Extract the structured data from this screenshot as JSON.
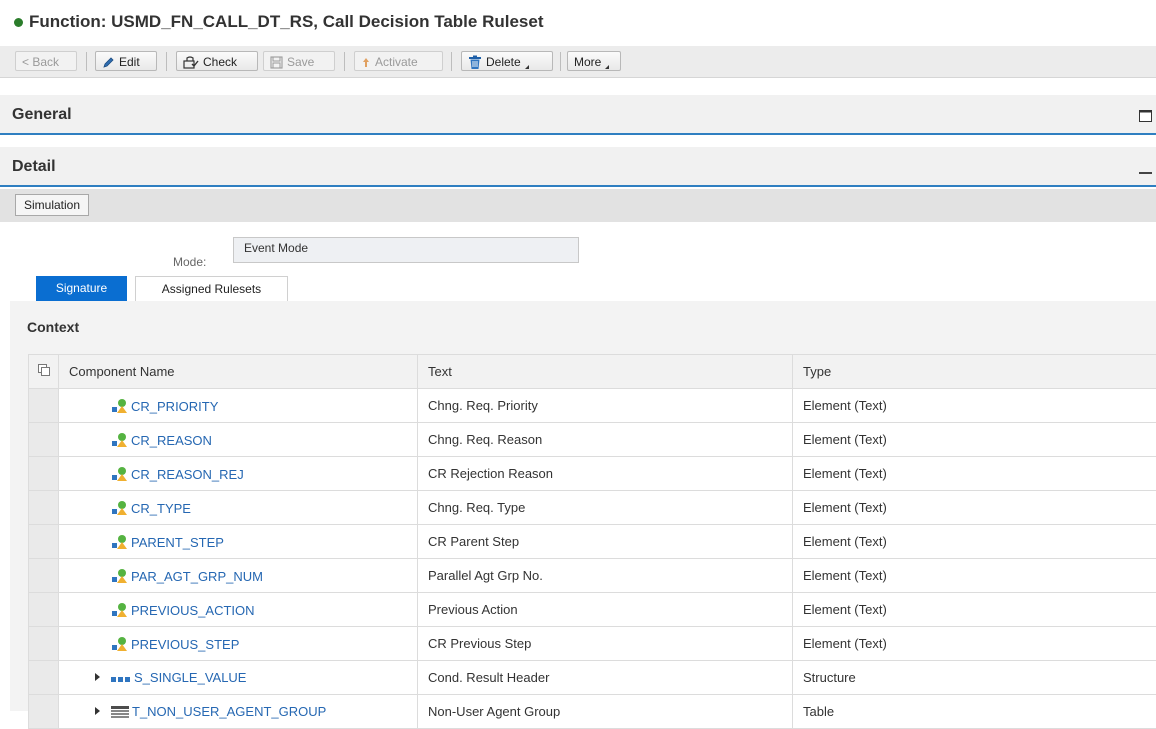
{
  "title": {
    "text": "Function: USMD_FN_CALL_DT_RS, Call Decision Table Ruleset",
    "status_color": "#2b7d2b"
  },
  "toolbar": {
    "back": "< Back",
    "edit": "Edit",
    "check": "Check",
    "save": "Save",
    "activate": "Activate",
    "delete": "Delete",
    "more": "More"
  },
  "sections": {
    "general": "General",
    "detail": "Detail"
  },
  "simulation_button": "Simulation",
  "mode": {
    "label": "Mode:",
    "value": "Event Mode"
  },
  "tabs": [
    {
      "label": "Signature",
      "active": true
    },
    {
      "label": "Assigned Rulesets",
      "active": false
    }
  ],
  "context": {
    "title": "Context",
    "columns": [
      "Component Name",
      "Text",
      "Type"
    ],
    "rows": [
      {
        "name": "CR_PRIORITY",
        "text": "Chng. Req. Priority",
        "type": "Element (Text)",
        "icon": "element-icon"
      },
      {
        "name": "CR_REASON",
        "text": "Chng. Req. Reason",
        "type": "Element (Text)",
        "icon": "element-icon"
      },
      {
        "name": "CR_REASON_REJ",
        "text": "CR Rejection Reason",
        "type": "Element (Text)",
        "icon": "element-icon"
      },
      {
        "name": "CR_TYPE",
        "text": "Chng. Req. Type",
        "type": "Element (Text)",
        "icon": "element-icon"
      },
      {
        "name": "PARENT_STEP",
        "text": "CR Parent Step",
        "type": "Element (Text)",
        "icon": "element-icon"
      },
      {
        "name": "PAR_AGT_GRP_NUM",
        "text": "Parallel Agt Grp No.",
        "type": "Element (Text)",
        "icon": "element-icon"
      },
      {
        "name": "PREVIOUS_ACTION",
        "text": "Previous Action",
        "type": "Element (Text)",
        "icon": "element-icon"
      },
      {
        "name": "PREVIOUS_STEP",
        "text": "CR Previous Step",
        "type": "Element (Text)",
        "icon": "element-icon"
      },
      {
        "name": "S_SINGLE_VALUE",
        "text": "Cond. Result Header",
        "type": "Structure",
        "icon": "structure-icon"
      },
      {
        "name": "T_NON_USER_AGENT_GROUP",
        "text": "Non-User Agent Group",
        "type": "Table",
        "icon": "table-icon"
      }
    ]
  },
  "colors": {
    "accent": "#0a6ed1",
    "section_underline": "#2f7fc1",
    "link": "#2567b2"
  }
}
